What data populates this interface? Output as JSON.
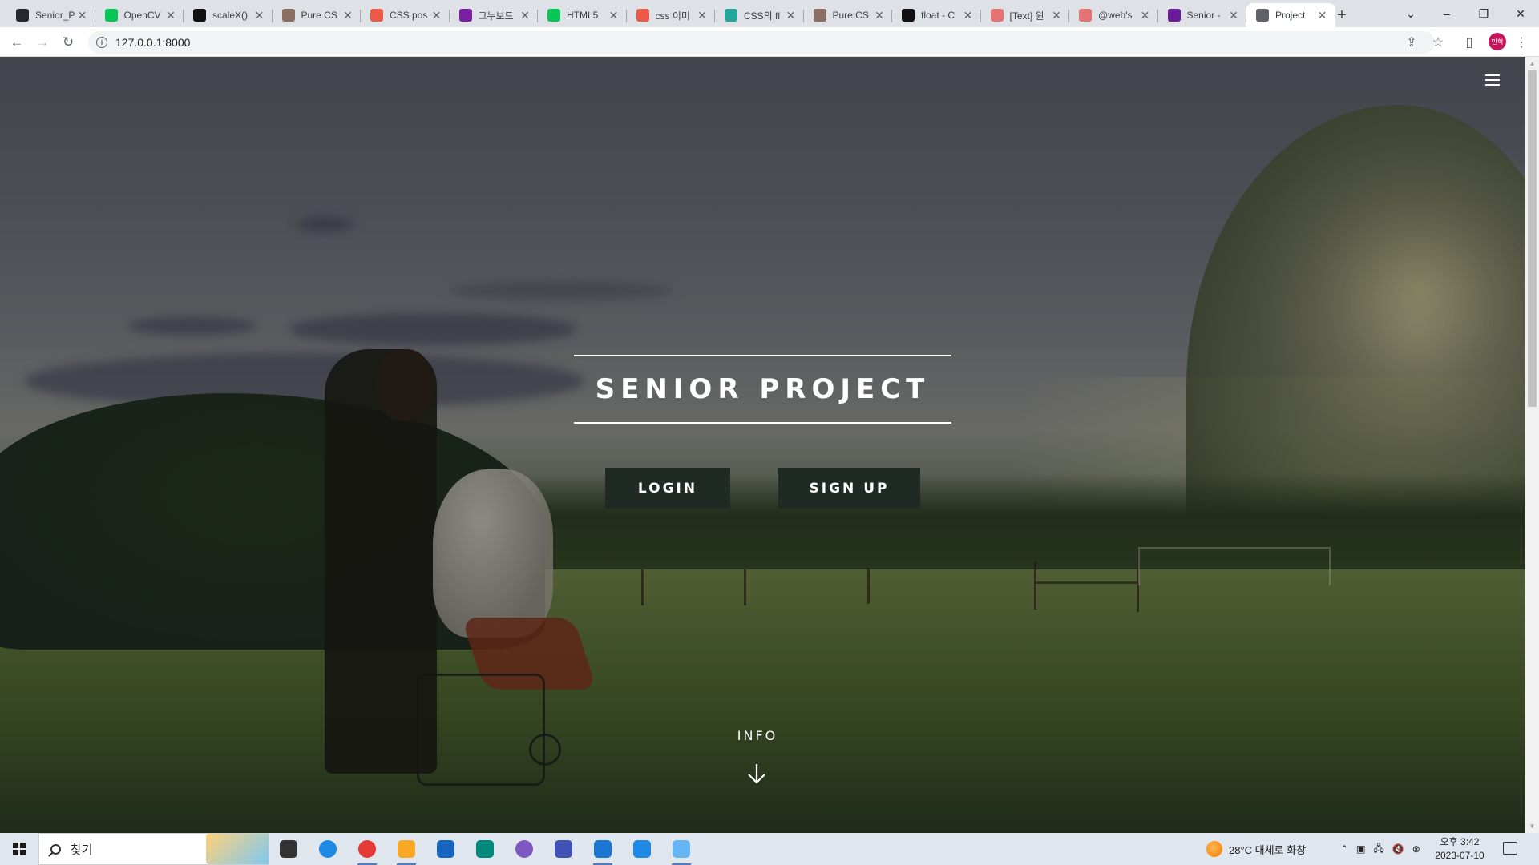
{
  "browser": {
    "tabs": [
      {
        "title": "Senior_P",
        "icon": "github-icon",
        "color": "#24292f"
      },
      {
        "title": "OpenCV",
        "icon": "line-icon",
        "color": "#06c755"
      },
      {
        "title": "scaleX()",
        "icon": "mdn-icon",
        "color": "#111111"
      },
      {
        "title": "Pure CS",
        "icon": "puzzle-icon",
        "color": "#8d6e63"
      },
      {
        "title": "CSS pos",
        "icon": "tistory-icon",
        "color": "#eb5a46"
      },
      {
        "title": "그누보드",
        "icon": "sir-icon",
        "color": "#7b1fa2"
      },
      {
        "title": "HTML5",
        "icon": "line-icon",
        "color": "#06c755"
      },
      {
        "title": "css 이미",
        "icon": "tistory-icon",
        "color": "#eb5a46"
      },
      {
        "title": "CSS의 fl",
        "icon": "page-icon",
        "color": "#26a69a"
      },
      {
        "title": "Pure CS",
        "icon": "puzzle-icon",
        "color": "#8d6e63"
      },
      {
        "title": "float - C",
        "icon": "mdn-icon",
        "color": "#111111"
      },
      {
        "title": "[Text] 윈",
        "icon": "image-icon",
        "color": "#e57373"
      },
      {
        "title": "@web's",
        "icon": "image-icon",
        "color": "#e57373"
      },
      {
        "title": "Senior -",
        "icon": "project-icon",
        "color": "#6a1b9a"
      },
      {
        "title": "Project",
        "icon": "globe-icon",
        "color": "#5f6368",
        "active": true
      }
    ],
    "url": "127.0.0.1:8000",
    "profile_initials": "민혁"
  },
  "page": {
    "title": "SENIOR PROJECT",
    "login_label": "LOGIN",
    "signup_label": "SIGN UP",
    "info_label": "INFO"
  },
  "taskbar": {
    "search_placeholder": "찾기",
    "weather": "28°C 대체로 화창",
    "time": "오후 3:42",
    "date": "2023-07-10",
    "apps": [
      {
        "name": "task-view-icon",
        "color": "#333333"
      },
      {
        "name": "edge-icon",
        "color": "#1e88e5"
      },
      {
        "name": "chrome-icon",
        "color": "#e53935",
        "running": true
      },
      {
        "name": "file-explorer-icon",
        "color": "#f9a825",
        "running": true
      },
      {
        "name": "mail-icon",
        "color": "#1565c0"
      },
      {
        "name": "app-teal-icon",
        "color": "#00897b"
      },
      {
        "name": "github-desktop-icon",
        "color": "#7e57c2"
      },
      {
        "name": "python-icon",
        "color": "#3f51b5"
      },
      {
        "name": "vscode-icon",
        "color": "#1976d2",
        "running": true
      },
      {
        "name": "app-blue-icon",
        "color": "#1e88e5"
      },
      {
        "name": "notepad-icon",
        "color": "#64b5f6",
        "running": true
      }
    ]
  }
}
